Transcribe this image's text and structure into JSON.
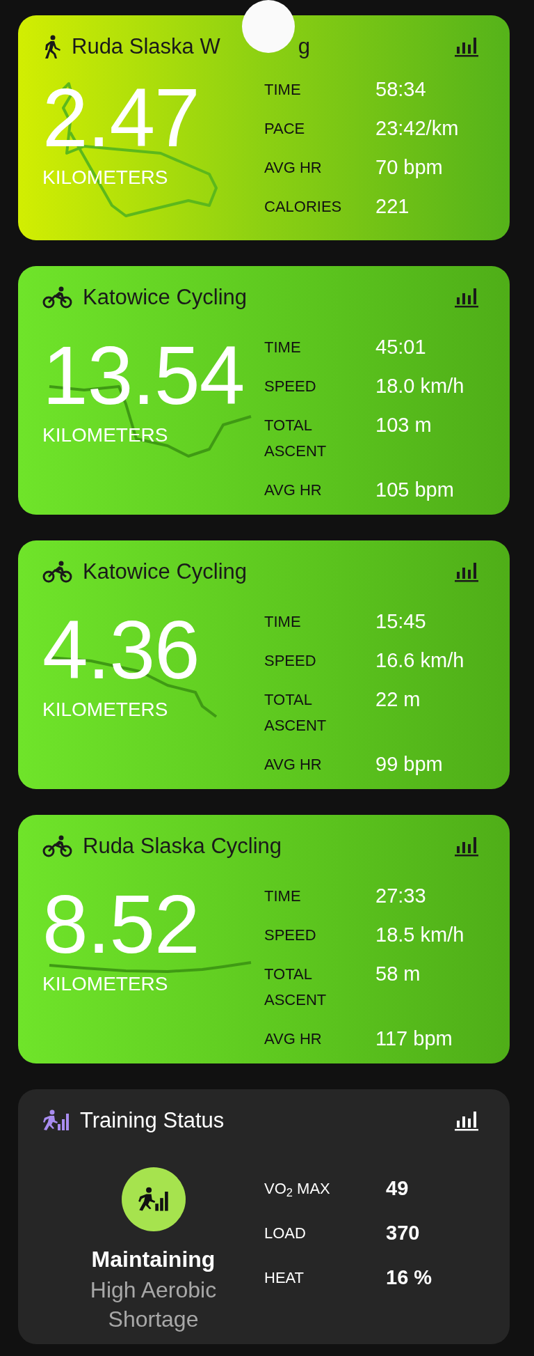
{
  "touch_indicator": true,
  "activities": [
    {
      "kind": "walking",
      "title": "Ruda Slaska W",
      "title_end": "g",
      "distance": "2.47",
      "unit": "KILOMETERS",
      "stats": [
        {
          "label": "TIME",
          "value": "58:34"
        },
        {
          "label": "PACE",
          "value": "23:42/km"
        },
        {
          "label": "AVG HR",
          "value": "70 bpm"
        },
        {
          "label": "CALORIES",
          "value": "221"
        }
      ]
    },
    {
      "kind": "cycling",
      "title": "Katowice Cycling",
      "distance": "13.54",
      "unit": "KILOMETERS",
      "stats": [
        {
          "label": "TIME",
          "value": "45:01"
        },
        {
          "label": "SPEED",
          "value": "18.0 km/h"
        },
        {
          "label": "TOTAL ASCENT",
          "value": "103 m"
        },
        {
          "label": "AVG HR",
          "value": "105 bpm"
        }
      ]
    },
    {
      "kind": "cycling",
      "title": "Katowice Cycling",
      "distance": "4.36",
      "unit": "KILOMETERS",
      "stats": [
        {
          "label": "TIME",
          "value": "15:45"
        },
        {
          "label": "SPEED",
          "value": "16.6 km/h"
        },
        {
          "label": "TOTAL ASCENT",
          "value": "22 m"
        },
        {
          "label": "AVG HR",
          "value": "99 bpm"
        }
      ]
    },
    {
      "kind": "cycling",
      "title": "Ruda Slaska Cycling",
      "distance": "8.52",
      "unit": "KILOMETERS",
      "stats": [
        {
          "label": "TIME",
          "value": "27:33"
        },
        {
          "label": "SPEED",
          "value": "18.5 km/h"
        },
        {
          "label": "TOTAL ASCENT",
          "value": "58 m"
        },
        {
          "label": "AVG HR",
          "value": "117 bpm"
        }
      ]
    }
  ],
  "training_status": {
    "title": "Training Status",
    "status": "Maintaining",
    "detail": "High Aerobic Shortage",
    "stats": [
      {
        "label": "VO$_{2}$ MAX",
        "value": "49"
      },
      {
        "label": "LOAD",
        "value": "370"
      },
      {
        "label": "HEAT",
        "value": "16 %"
      }
    ]
  }
}
